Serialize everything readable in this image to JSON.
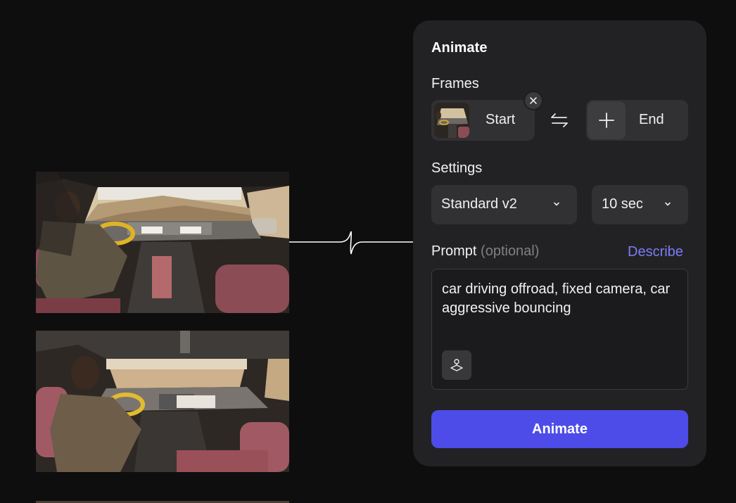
{
  "panel": {
    "title": "Animate",
    "frames": {
      "label": "Frames",
      "start_label": "Start",
      "end_label": "End",
      "start_thumbnail": "car-interior-image",
      "remove_icon": "close-icon",
      "swap_icon": "swap-arrows-icon",
      "add_icon": "plus-icon"
    },
    "settings": {
      "label": "Settings",
      "model": "Standard v2",
      "duration": "10 sec",
      "dropdown_icon": "chevron-down-icon"
    },
    "prompt": {
      "label": "Prompt",
      "optional": "(optional)",
      "describe_link": "Describe",
      "value": "car driving offroad, fixed camera, car aggressive bouncing",
      "enhance_icon": "enhance-prompt-icon"
    },
    "animate_button": "Animate"
  },
  "images": [
    {
      "name": "car-interior-driver-wide"
    },
    {
      "name": "car-interior-driver-side"
    }
  ],
  "colors": {
    "background": "#0e0e0f",
    "panel": "#222224",
    "accent": "#4d4ce8",
    "link": "#7c7cf8"
  }
}
